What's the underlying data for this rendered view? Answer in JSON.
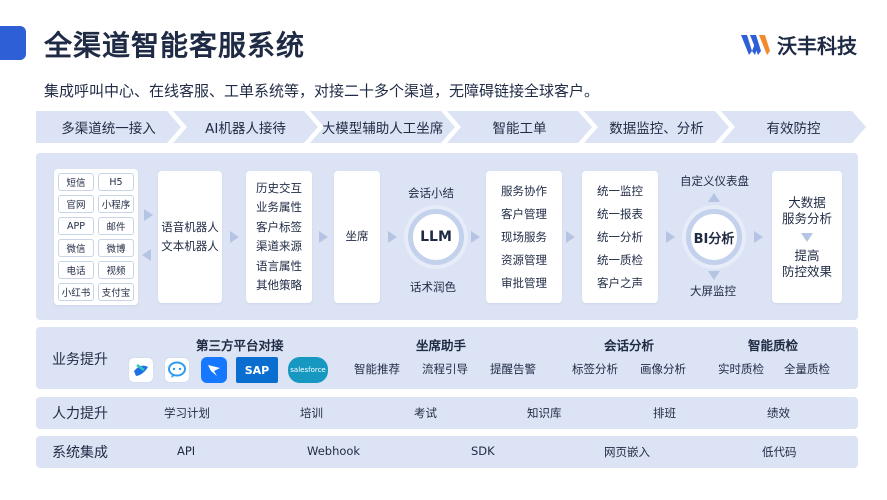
{
  "header": {
    "title": "全渠道智能客服系统",
    "logo_text": "沃丰科技",
    "subtitle": "集成呼叫中心、在线客服、工单系统等，对接二十多个渠道，无障碍链接全球客户。"
  },
  "stages": [
    "多渠道统一接入",
    "AI机器人接待",
    "大模型辅助人工坐席",
    "智能工单",
    "数据监控、分析",
    "有效防控"
  ],
  "channels": [
    "短信",
    "H5",
    "官网",
    "小程序",
    "APP",
    "邮件",
    "微信",
    "微博",
    "电话",
    "视频",
    "小红书",
    "支付宝"
  ],
  "robots": [
    "语音机器人",
    "文本机器人"
  ],
  "attributes": [
    "历史交互",
    "业务属性",
    "客户标签",
    "渠道来源",
    "语言属性",
    "其他策略"
  ],
  "seat": "坐席",
  "llm": {
    "label": "LLM",
    "top": "会话小结",
    "bottom": "话术润色"
  },
  "tickets": [
    "服务协作",
    "客户管理",
    "现场服务",
    "资源管理",
    "审批管理"
  ],
  "monitor": [
    "统一监控",
    "统一报表",
    "统一分析",
    "统一质检",
    "客户之声"
  ],
  "bi": {
    "label": "BI分析",
    "top": "自定义仪表盘",
    "bottom": "大屏监控"
  },
  "prevention": {
    "top": "大数据\n服务分析",
    "bottom": "提高\n防控效果"
  },
  "business": {
    "label": "业务提升",
    "groups": [
      {
        "title": "第三方平台对接",
        "items": []
      },
      {
        "title": "坐席助手",
        "items": [
          "智能推荐",
          "流程引导",
          "提醒告警"
        ]
      },
      {
        "title": "会话分析",
        "items": [
          "标签分析",
          "画像分析"
        ]
      },
      {
        "title": "智能质检",
        "items": [
          "实时质检",
          "全量质检"
        ]
      }
    ],
    "platform_icons": [
      {
        "name": "feishu-icon",
        "text": "",
        "color": "#1f6fe5"
      },
      {
        "name": "dingtalk-chat-icon",
        "text": "",
        "color": "#2f9bf0"
      },
      {
        "name": "dingtalk-icon",
        "text": "",
        "color": "#1677ff"
      },
      {
        "name": "sap-logo",
        "text": "SAP",
        "color": "#0a6ed1"
      },
      {
        "name": "salesforce-logo",
        "text": "salesforce",
        "color": "#1798c1"
      }
    ]
  },
  "hr": {
    "label": "人力提升",
    "items": [
      "学习计划",
      "培训",
      "考试",
      "知识库",
      "排班",
      "绩效"
    ]
  },
  "integration": {
    "label": "系统集成",
    "items": [
      "API",
      "Webhook",
      "SDK",
      "网页嵌入",
      "低代码"
    ]
  },
  "colors": {
    "accent": "#2f5fd6",
    "panel": "#dbe3f4",
    "arrow": "#b6c4e4",
    "text": "#1f2a44"
  }
}
